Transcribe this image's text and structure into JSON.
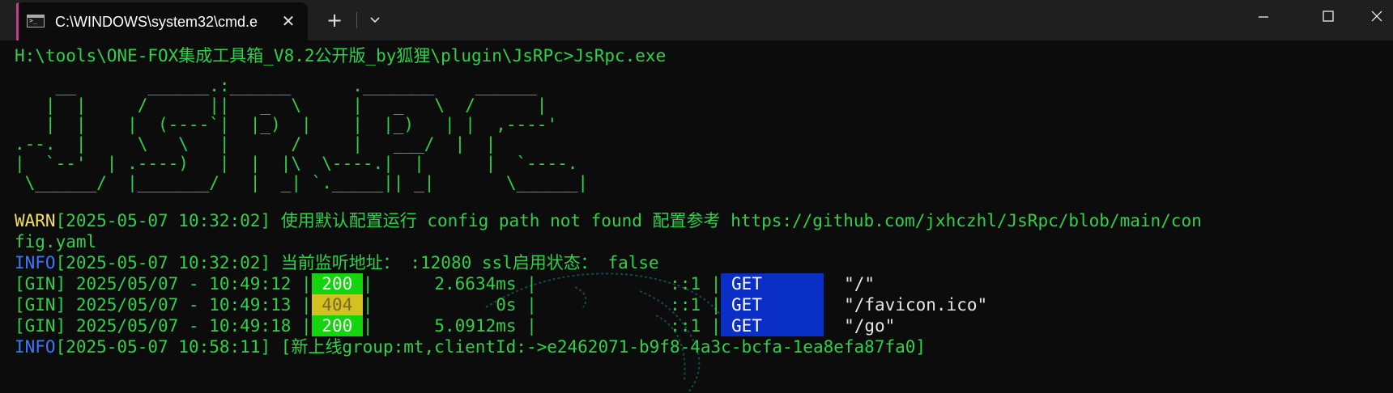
{
  "window": {
    "tab_title": "C:\\WINDOWS\\system32\\cmd.e",
    "tab_close": "✕",
    "new_tab": "+"
  },
  "terminal": {
    "command_line": "H:\\tools\\ONE-FOX集成工具箱_V8.2公开版_by狐狸\\plugin\\JsRPc>JsRpc.exe",
    "banner": [
      "    __       ______.:______      ._______    ______",
      "   |  |     /      ||   _  \\     |   _   \\  /      |",
      "   |  |    |  (----`|  |_)  |    |  |_)   | |  ,----'",
      ".--.  |     \\   \\   |      /     |   ___/  |  |",
      "|  `--'  | .----)   |  |  |\\  \\----.|  |      |  `----.",
      " \\______/  |_______/   |  _| `._____|| _|       \\______|"
    ],
    "warn": {
      "level": "WARN",
      "text": "[2025-05-07 10:32:02] 使用默认配置运行 config path not found 配置参考 https://github.com/jxhczhl/JsRpc/blob/main/con",
      "wrap": "fig.yaml"
    },
    "info1": {
      "level": "INFO",
      "text": "[2025-05-07 10:32:02] 当前监听地址： :12080 ssl启用状态： false"
    },
    "gin_rows": [
      {
        "prefix": "[GIN] 2025/05/07 - 10:49:12 |",
        "status": " 200 ",
        "status_kind": "ok",
        "latency": "|      2.6634ms |",
        "ip": "             ::1 |",
        "method": " GET      ",
        "path": "  \"/\""
      },
      {
        "prefix": "[GIN] 2025/05/07 - 10:49:13 |",
        "status": " 404 ",
        "status_kind": "notfound",
        "latency": "|            0s |",
        "ip": "             ::1 |",
        "method": " GET      ",
        "path": "  \"/favicon.ico\""
      },
      {
        "prefix": "[GIN] 2025/05/07 - 10:49:18 |",
        "status": " 200 ",
        "status_kind": "ok",
        "latency": "|      5.0912ms |",
        "ip": "             ::1 |",
        "method": " GET      ",
        "path": "  \"/go\""
      }
    ],
    "info2": {
      "level": "INFO",
      "text": "[2025-05-07 10:58:11] [新上线group:mt,clientId:->e2462071-b9f8-4a3c-bcfa-1ea8efa87fa0]"
    }
  },
  "colors": {
    "terminal_bg": "#0c0c0c",
    "text_green": "#2fd14a",
    "warn_yellow": "#f1e05a",
    "info_blue": "#3b78ff",
    "status_200": "#13d40d",
    "status_404": "#d3c021",
    "method_get": "#0a2fc7",
    "tab_accent": "#c0408a"
  },
  "icons": {
    "tab_icon": "cmd-terminal-icon",
    "dropdown": "chevron-down-icon",
    "minimize": "minimize-icon",
    "maximize": "maximize-icon",
    "close": "close-icon"
  }
}
